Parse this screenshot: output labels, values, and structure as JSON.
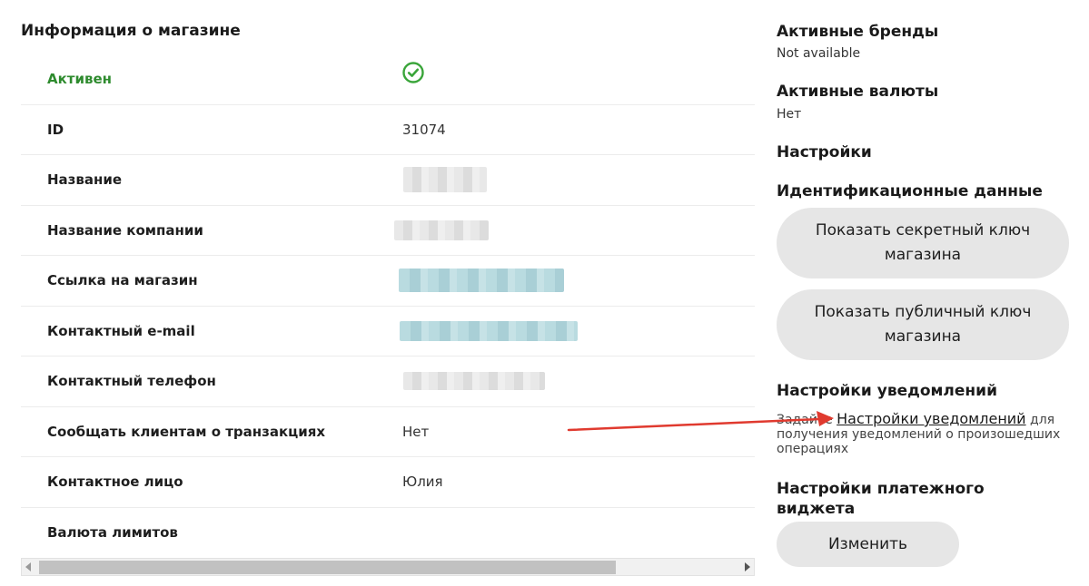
{
  "shop_info": {
    "title": "Информация о магазине",
    "rows": [
      {
        "label": "Активен",
        "value": "",
        "status_icon": "check-circle-icon"
      },
      {
        "label": "ID",
        "value": "31074"
      },
      {
        "label": "Название",
        "value": ""
      },
      {
        "label": "Название компании",
        "value": ""
      },
      {
        "label": "Ссылка на магазин",
        "value": ""
      },
      {
        "label": "Контактный e-mail",
        "value": ""
      },
      {
        "label": "Контактный телефон",
        "value": ""
      },
      {
        "label": "Сообщать клиентам о транзакциях",
        "value": "Нет"
      },
      {
        "label": "Контактное лицо",
        "value": "Юлия"
      },
      {
        "label": "Валюта лимитов",
        "value": ""
      }
    ]
  },
  "sidebar": {
    "active_brands": {
      "title": "Активные бренды",
      "value": "Not available"
    },
    "active_currencies": {
      "title": "Активные валюты",
      "value": "Нет"
    },
    "settings_title": "Настройки",
    "credentials": {
      "title": "Идентификационные данные",
      "secret_key_button": "Показать секретный ключ магазина",
      "public_key_button": "Показать публичный ключ магазина"
    },
    "notifications": {
      "title": "Настройки уведомлений",
      "text_before": "Задайте",
      "link": "Настройки уведомлений",
      "text_after": "для получения уведомлений о произошедших операциях"
    },
    "payment_widget": {
      "title": "Настройки платежного виджета",
      "edit_button": "Изменить"
    }
  },
  "colors": {
    "active_green": "#2e8b2e",
    "check_icon_green": "#3aa53a",
    "button_bg": "#e6e6e6",
    "annotation_arrow": "#e03a2f"
  }
}
